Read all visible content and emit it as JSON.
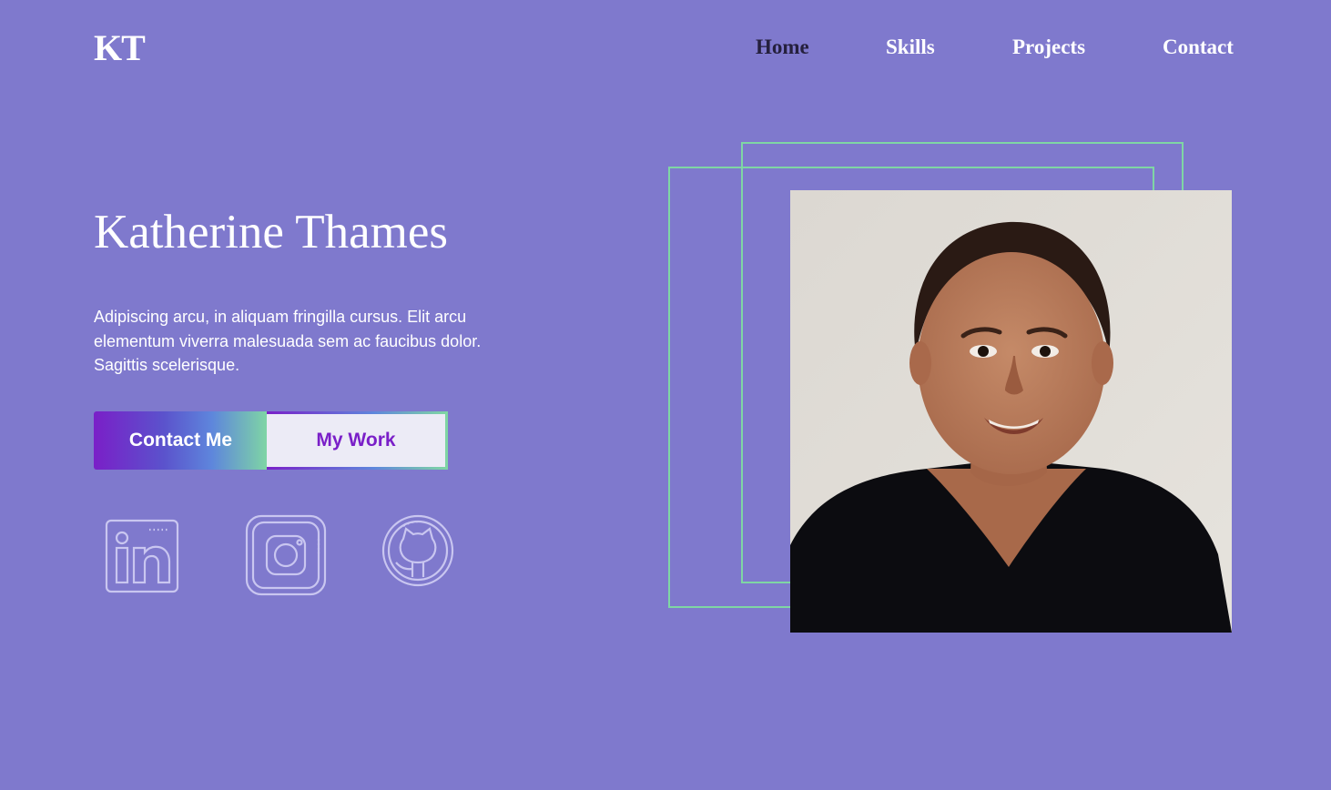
{
  "header": {
    "logo": "KT",
    "nav": [
      {
        "label": "Home",
        "active": true
      },
      {
        "label": "Skills",
        "active": false
      },
      {
        "label": "Projects",
        "active": false
      },
      {
        "label": "Contact",
        "active": false
      }
    ]
  },
  "hero": {
    "name": "Katherine Thames",
    "description": "Adipiscing arcu, in aliquam fringilla cursus. Elit arcu elementum viverra malesuada sem ac faucibus dolor. Sagittis scelerisque.",
    "primary_button": "Contact Me",
    "secondary_button": "My Work",
    "social": [
      {
        "icon": "linkedin-icon"
      },
      {
        "icon": "instagram-icon"
      },
      {
        "icon": "github-icon"
      }
    ]
  },
  "theme": {
    "background": "#7f79cd",
    "accent_green": "#7fd6a4",
    "accent_purple": "#7a1fc8",
    "active_nav": "#25203d"
  }
}
